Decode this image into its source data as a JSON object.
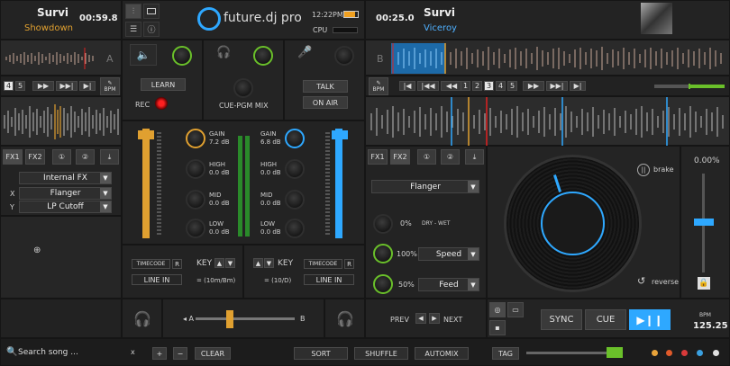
{
  "app": {
    "brand": "future.dj pro",
    "time": "12:22PM",
    "cpu_label": "CPU"
  },
  "deck_a": {
    "title": "Survi",
    "artist": "Showdown",
    "time": "00:59.8",
    "letter": "A",
    "loop_nums": [
      "4",
      "5"
    ],
    "bpm_label": "BPM",
    "fx_tabs": [
      "FX1",
      "FX2"
    ],
    "fx_header": "Internal FX",
    "fx_x_label": "X",
    "fx_x_value": "Flanger",
    "fx_y_label": "Y",
    "fx_y_value": "LP Cutoff"
  },
  "deck_b": {
    "title": "Survi",
    "artist": "Viceroy",
    "time": "00:25.0",
    "letter": "B",
    "bpm_label": "BPM",
    "loop_nums": [
      "1",
      "2",
      "3",
      "4",
      "5"
    ],
    "active_loop": "3",
    "fx_tabs": [
      "FX1",
      "FX2"
    ],
    "fx_select": "Flanger",
    "dry_wet_value": "0%",
    "dry_wet_label": "DRY - WET",
    "speed_value": "100%",
    "speed_label": "Speed",
    "feed_value": "50%",
    "feed_label": "Feed",
    "brake_label": "brake",
    "reverse_label": "reverse",
    "pitch": "0.00%",
    "sync": "SYNC",
    "cue": "CUE",
    "bpm_small": "BPM",
    "bpm_value": "125.25",
    "prev": "PREV",
    "next": "NEXT"
  },
  "mixer": {
    "learn": "LEARN",
    "rec": "REC",
    "cue_pgm": "CUE-PGM MIX",
    "talk": "TALK",
    "on_air": "ON AIR",
    "left_ch": {
      "gain_label": "GAIN",
      "gain_value": "7.2 dB",
      "high_label": "HIGH",
      "high_value": "0.0 dB",
      "mid_label": "MID",
      "mid_value": "0.0 dB",
      "low_label": "LOW",
      "low_value": "0.0 dB"
    },
    "right_ch": {
      "gain_label": "GAIN",
      "gain_value": "6.8 dB",
      "high_label": "HIGH",
      "high_value": "0.0 dB",
      "mid_label": "MID",
      "mid_value": "0.0 dB",
      "low_label": "LOW",
      "low_value": "0.0 dB"
    },
    "left_key": {
      "timecode": "TIMECODE",
      "r": "R",
      "line_in": "LINE IN",
      "key_label": "KEY",
      "key_value": "= (10m/Bm)"
    },
    "right_key": {
      "timecode": "TIMECODE",
      "r": "R",
      "line_in": "LINE IN",
      "key_label": "KEY",
      "key_value": "= (10/D)"
    },
    "xfader_a": "A",
    "xfader_b": "B"
  },
  "bottom": {
    "search_placeholder": "Search song ...",
    "clear_x": "x",
    "plus": "+",
    "minus": "−",
    "clear": "CLEAR",
    "sort": "SORT",
    "shuffle": "SHUFFLE",
    "automix": "AUTOMIX",
    "tag": "TAG",
    "tag_colors": [
      "#e8a33a",
      "#e05a2a",
      "#d83a3a",
      "#3aa0e0",
      "#e0e0e0"
    ]
  },
  "colors": {
    "accent_blue": "#2ea8ff",
    "accent_orange": "#f0a020",
    "deck_b_wave": "#3a8fd0",
    "red": "#e02020",
    "green": "#6ac02a"
  }
}
